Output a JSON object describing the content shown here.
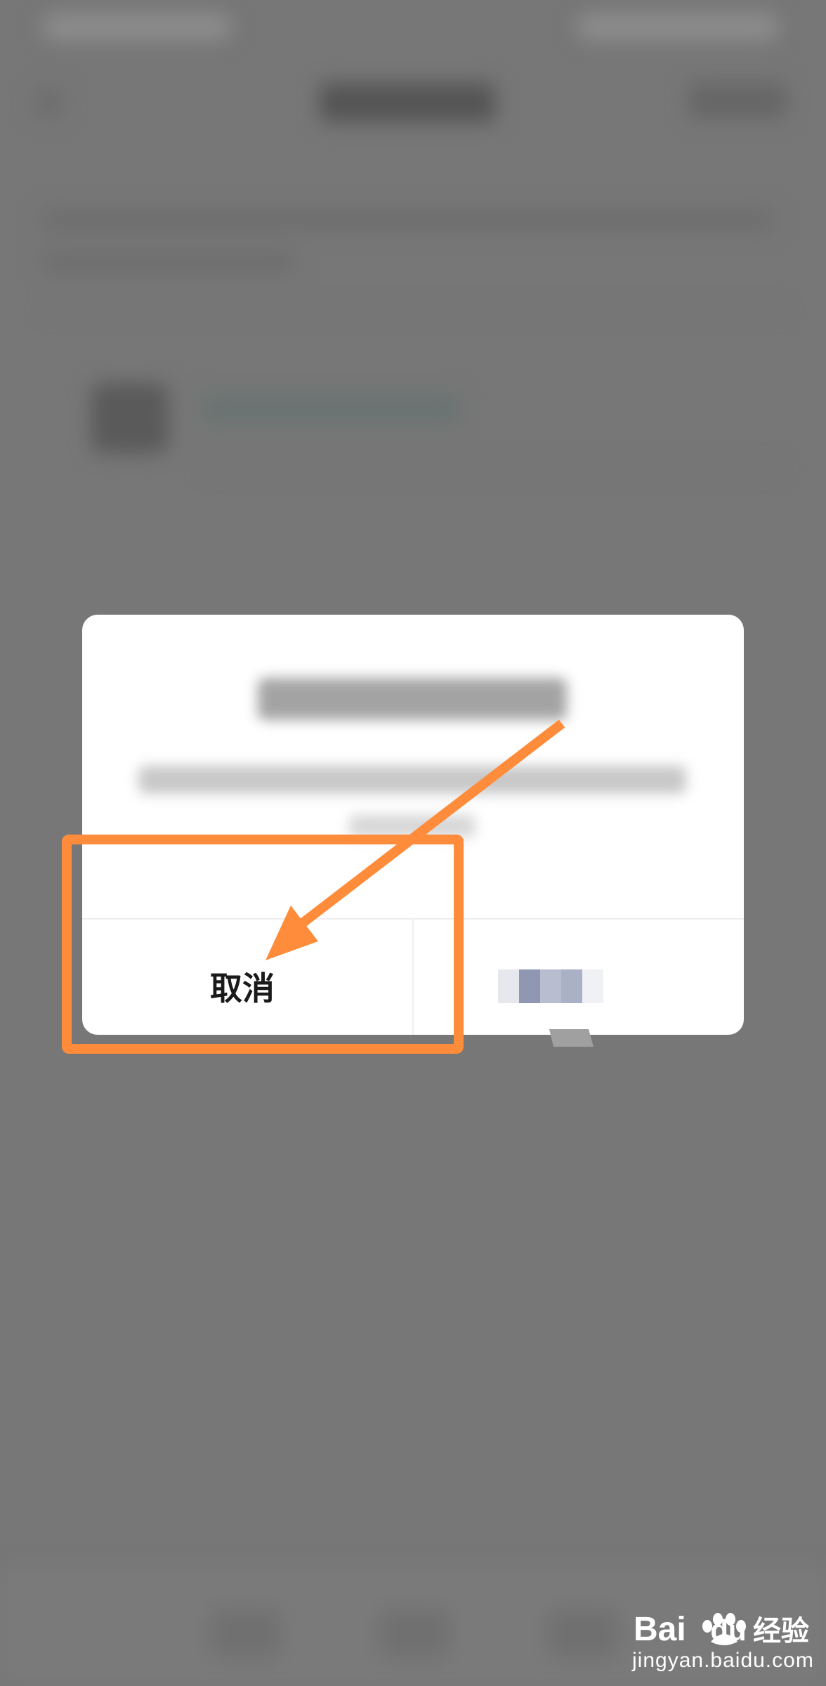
{
  "dialog": {
    "cancel_label": "取消",
    "confirm_label": ""
  },
  "annotation": {
    "highlight_color": "#FF8C3A",
    "arrow_color": "#FF8C3A"
  },
  "watermark": {
    "logo_text": "Bai du 经验",
    "url": "jingyan.baidu.com"
  },
  "colors": {
    "overlay": "#777777",
    "dialog_bg": "#ffffff"
  }
}
